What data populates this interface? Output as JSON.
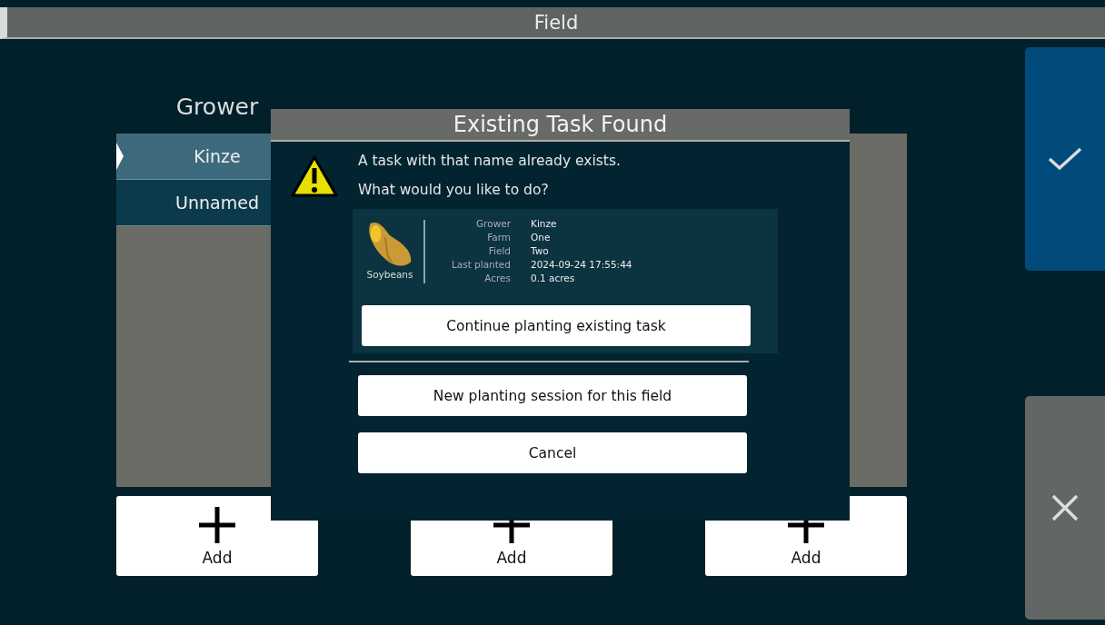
{
  "title": "Field",
  "columns": [
    {
      "heading": "Grower",
      "items": [
        {
          "label": "Kinze",
          "selected": true
        },
        {
          "label": "Unnamed",
          "selected": false
        }
      ],
      "add_label": "Add"
    },
    {
      "add_label": "Add"
    },
    {
      "add_label": "Add"
    }
  ],
  "dialog": {
    "title": "Existing Task Found",
    "message": "A task with that name already exists.",
    "question": "What would you like to do?",
    "task": {
      "crop": "Soybeans",
      "details": [
        {
          "label": "Grower",
          "value": "Kinze"
        },
        {
          "label": "Farm",
          "value": "One"
        },
        {
          "label": "Field",
          "value": "Two"
        },
        {
          "label": "Last planted",
          "value": "2024-09-24 17:55:44"
        },
        {
          "label": "Acres",
          "value": "0.1 acres"
        }
      ],
      "primary_action": "Continue planting existing task"
    },
    "actions": [
      "New planting session for this field",
      "Cancel"
    ]
  }
}
